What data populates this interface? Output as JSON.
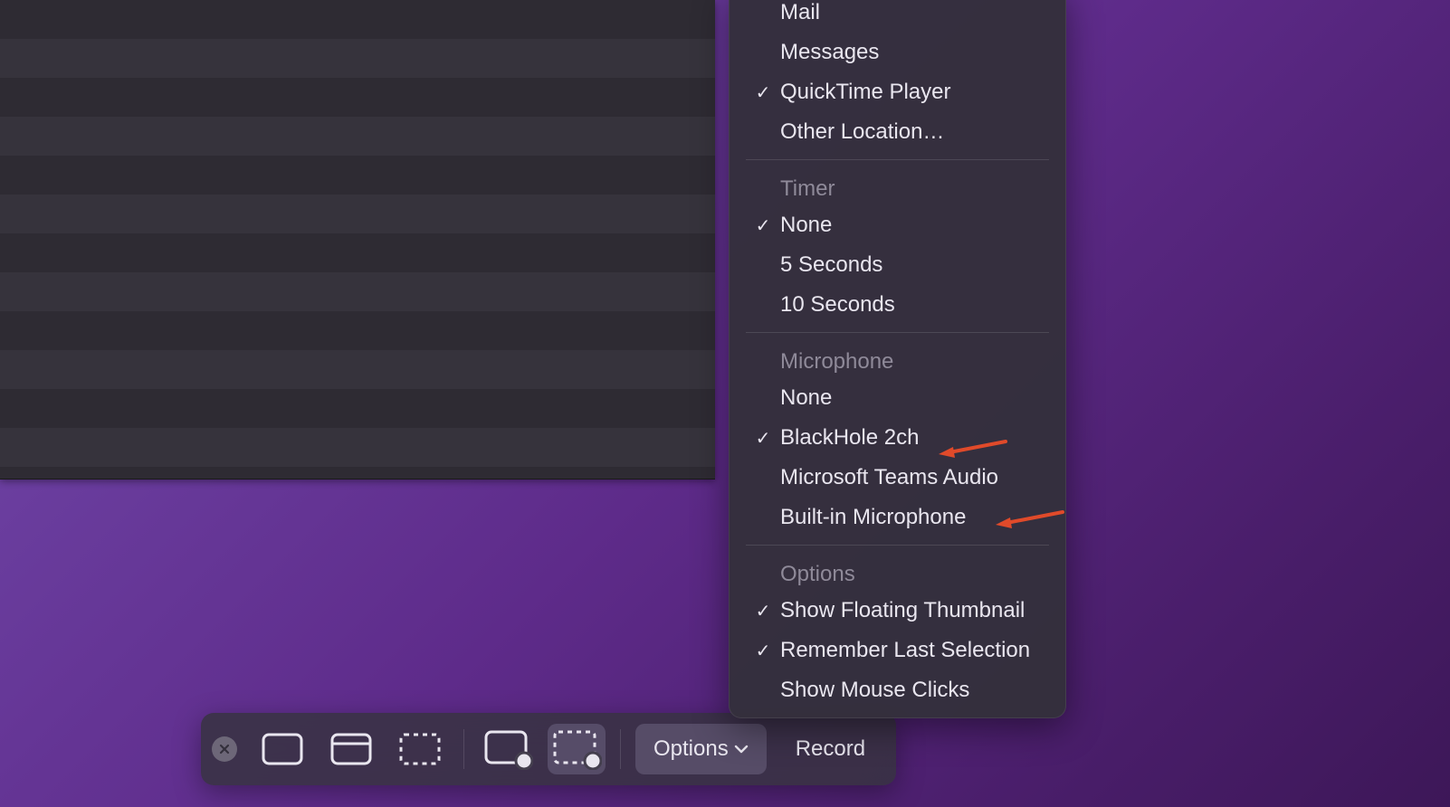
{
  "toolbar": {
    "options_label": "Options",
    "record_label": "Record"
  },
  "menu": {
    "save_to": {
      "items": [
        {
          "label": "Mail",
          "checked": false
        },
        {
          "label": "Messages",
          "checked": false
        },
        {
          "label": "QuickTime Player",
          "checked": true
        },
        {
          "label": "Other Location…",
          "checked": false
        }
      ]
    },
    "timer": {
      "header": "Timer",
      "items": [
        {
          "label": "None",
          "checked": true
        },
        {
          "label": "5 Seconds",
          "checked": false
        },
        {
          "label": "10 Seconds",
          "checked": false
        }
      ]
    },
    "microphone": {
      "header": "Microphone",
      "items": [
        {
          "label": "None",
          "checked": false
        },
        {
          "label": "BlackHole 2ch",
          "checked": true
        },
        {
          "label": "Microsoft Teams Audio",
          "checked": false
        },
        {
          "label": "Built-in Microphone",
          "checked": false
        }
      ]
    },
    "options": {
      "header": "Options",
      "items": [
        {
          "label": "Show Floating Thumbnail",
          "checked": true
        },
        {
          "label": "Remember Last Selection",
          "checked": true
        },
        {
          "label": "Show Mouse Clicks",
          "checked": false
        }
      ]
    }
  }
}
